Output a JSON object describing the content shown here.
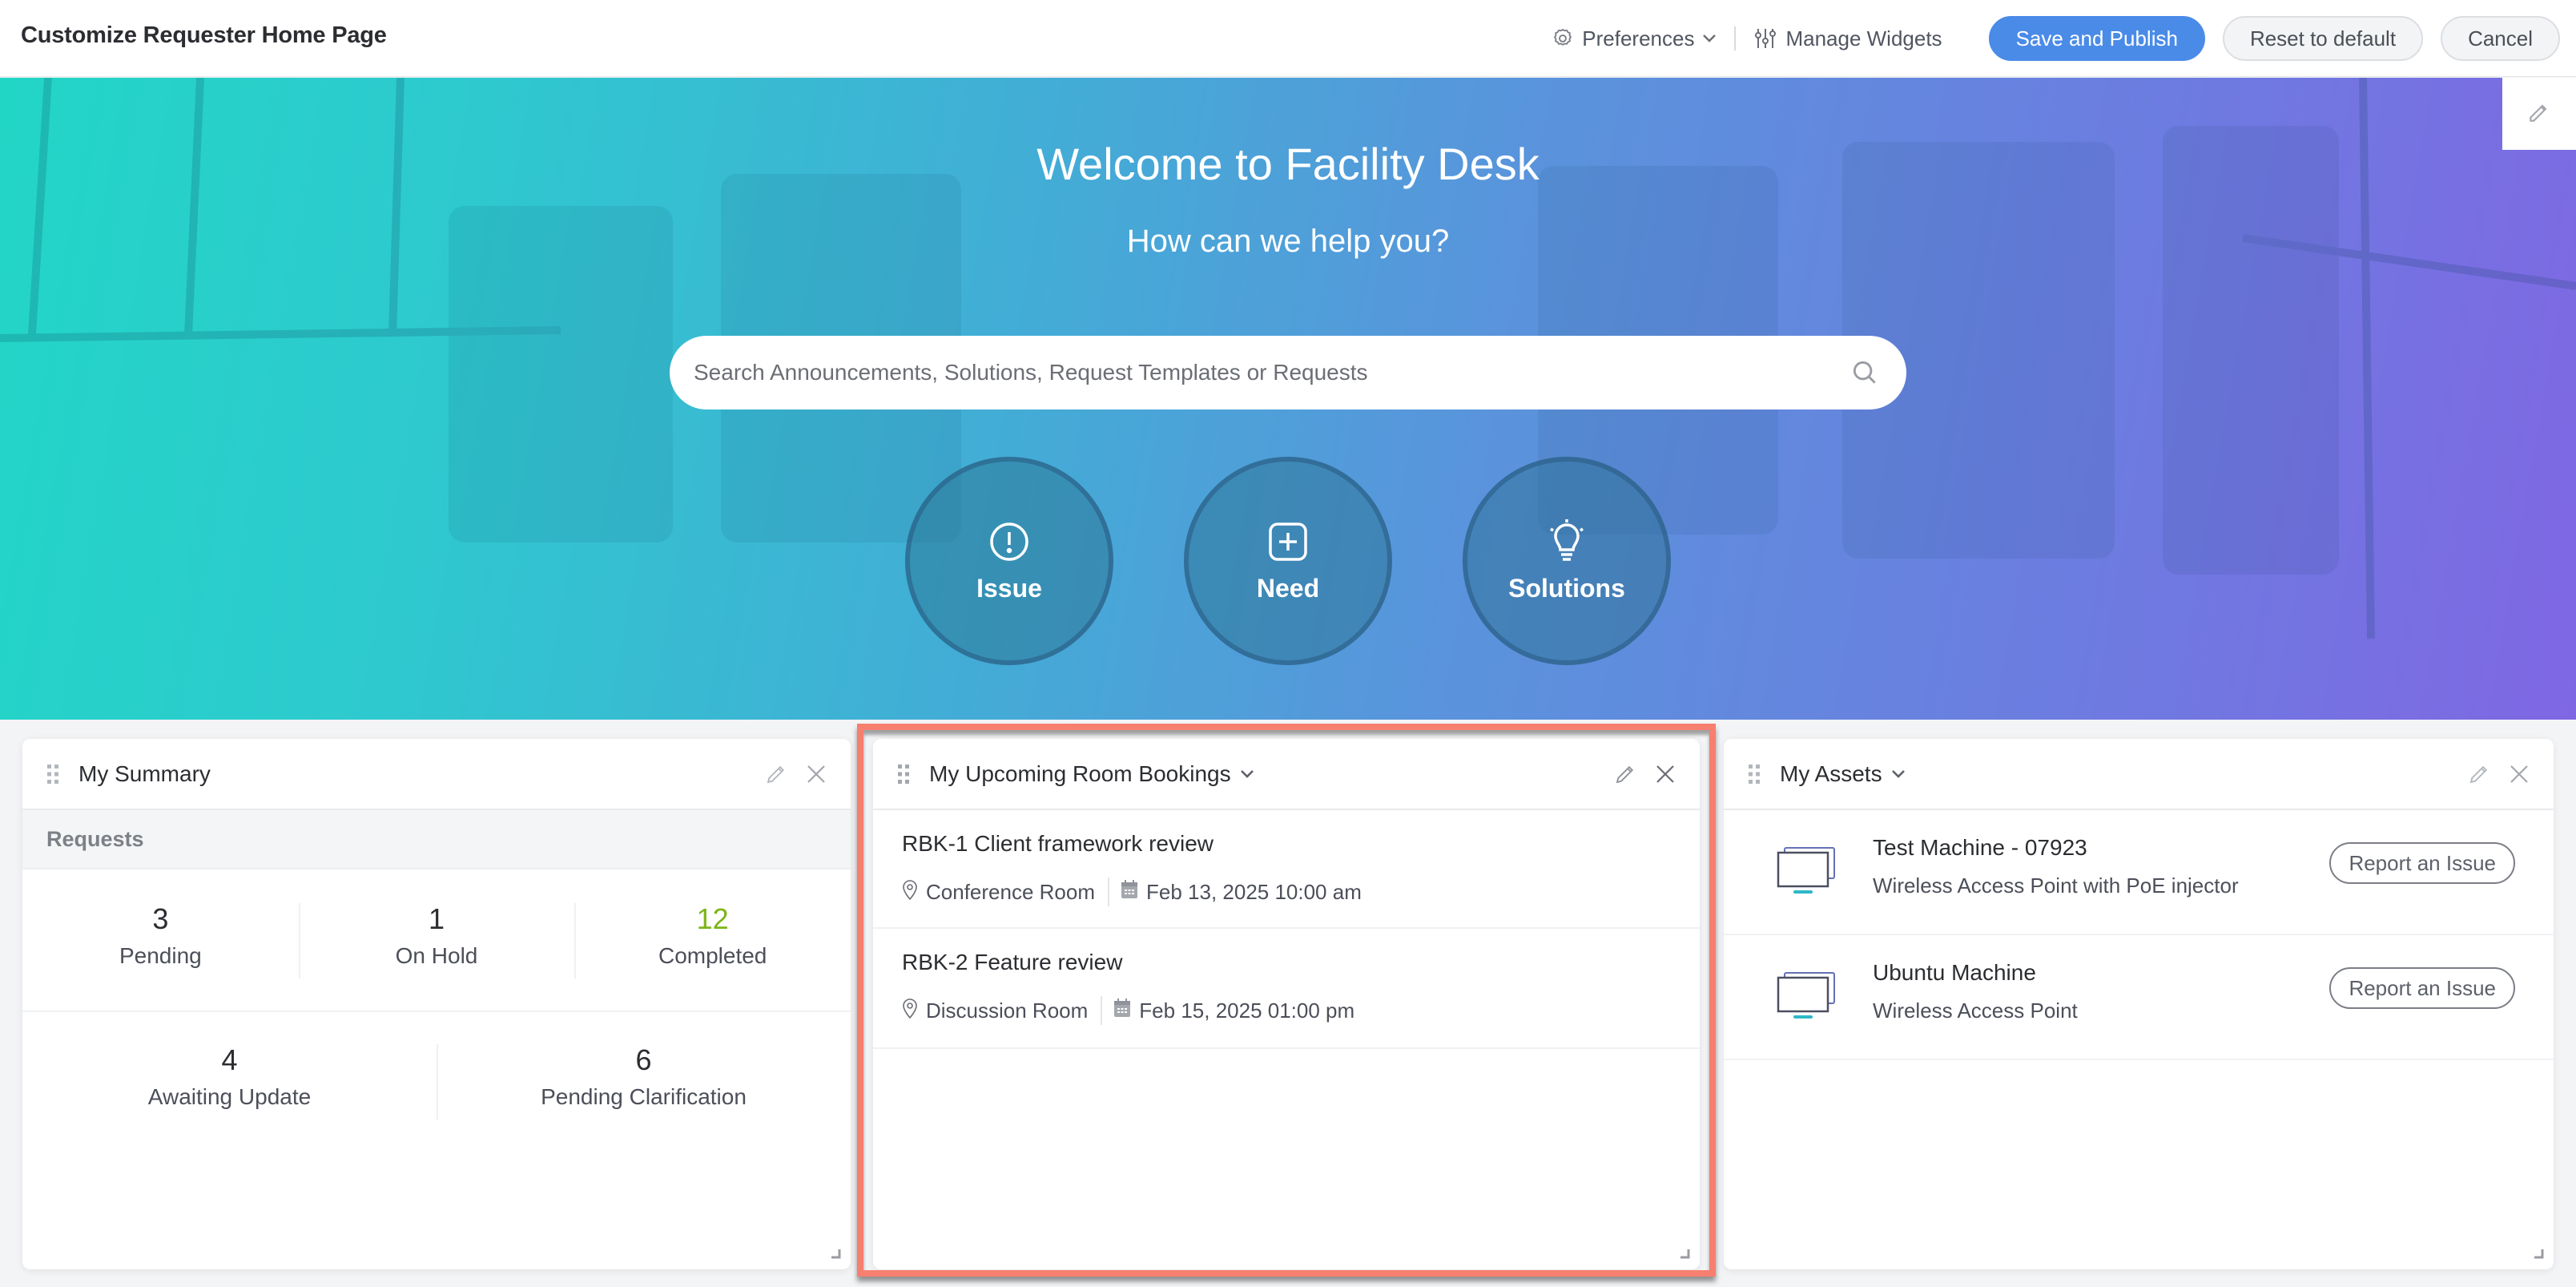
{
  "header": {
    "title": "Customize Requester Home Page",
    "preferences_label": "Preferences",
    "manage_widgets_label": "Manage Widgets",
    "save_publish_label": "Save and Publish",
    "reset_label": "Reset to default",
    "cancel_label": "Cancel",
    "primary_color": "#4a8be8"
  },
  "hero": {
    "title": "Welcome to Facility Desk",
    "subtitle": "How can we help you?",
    "search_placeholder": "Search Announcements, Solutions, Request Templates or Requests",
    "search_value": "",
    "quick_links": [
      {
        "label": "Issue",
        "icon": "exclamation-circle-icon"
      },
      {
        "label": "Need",
        "icon": "plus-square-icon"
      },
      {
        "label": "Solutions",
        "icon": "lightbulb-icon"
      }
    ]
  },
  "widgets": {
    "summary": {
      "title": "My Summary",
      "section": "Requests",
      "stats_row1": [
        {
          "value": "3",
          "label": "Pending"
        },
        {
          "value": "1",
          "label": "On Hold"
        },
        {
          "value": "12",
          "label": "Completed",
          "color": "#7cb518"
        }
      ],
      "stats_row2": [
        {
          "value": "4",
          "label": "Awaiting Update"
        },
        {
          "value": "6",
          "label": "Pending Clarification"
        }
      ]
    },
    "bookings": {
      "title": "My Upcoming Room Bookings",
      "highlight_color": "#f77f6f",
      "items": [
        {
          "title": "RBK-1 Client framework review",
          "room": "Conference Room",
          "datetime": "Feb 13, 2025 10:00 am"
        },
        {
          "title": "RBK-2 Feature review",
          "room": "Discussion Room",
          "datetime": "Feb 15, 2025 01:00 pm"
        }
      ]
    },
    "assets": {
      "title": "My Assets",
      "items": [
        {
          "name": "Test Machine - 07923",
          "type": "Wireless Access Point with PoE injector",
          "action": "Report an Issue"
        },
        {
          "name": "Ubuntu Machine",
          "type": "Wireless Access Point",
          "action": "Report an Issue"
        }
      ]
    }
  }
}
